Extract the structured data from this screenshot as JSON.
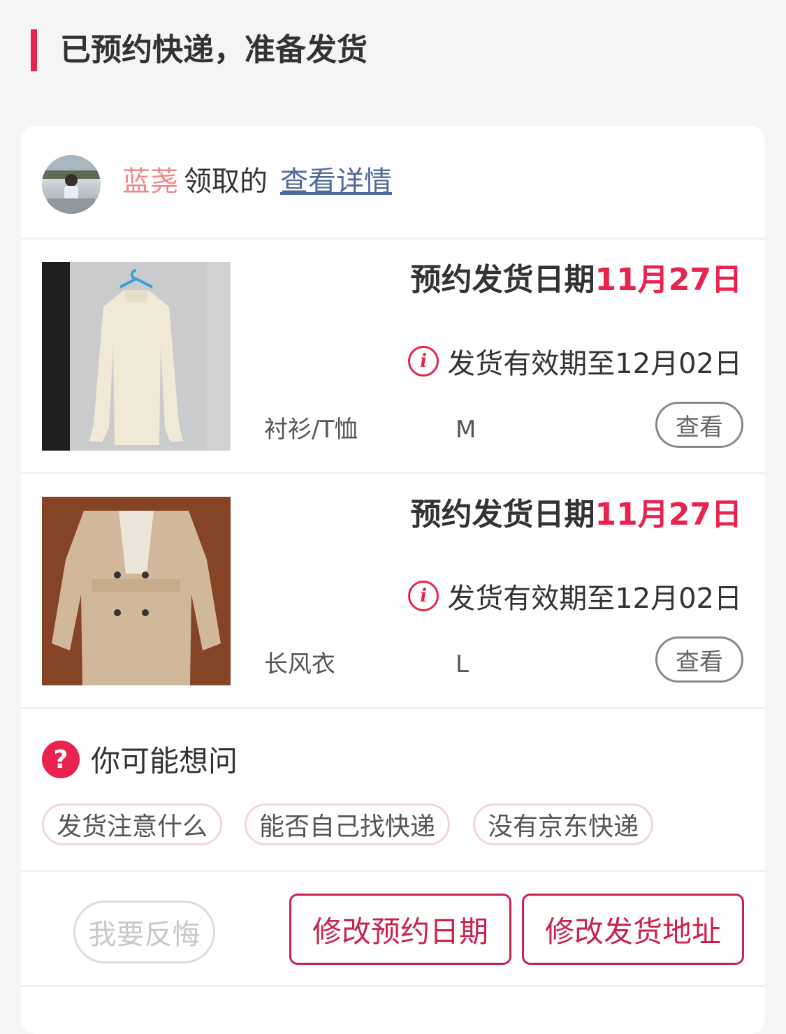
{
  "header": {
    "title": "已预约快递，准备发货"
  },
  "claimer": {
    "name": "蓝荛",
    "verb": "领取的",
    "link": "查看详情"
  },
  "items": [
    {
      "ship_date_label": "预约发货日期",
      "ship_date_value": "11月27日",
      "valid_text": "发货有效期至12月02日",
      "category": "衬衫/T恤",
      "size": "M",
      "view_label": "查看"
    },
    {
      "ship_date_label": "预约发货日期",
      "ship_date_value": "11月27日",
      "valid_text": "发货有效期至12月02日",
      "category": "长风衣",
      "size": "L",
      "view_label": "查看"
    }
  ],
  "faq": {
    "title": "你可能想问",
    "chips": [
      "发货注意什么",
      "能否自己找快递",
      "没有京东快递"
    ]
  },
  "actions": {
    "regret": "我要反悔",
    "change_date": "修改预约日期",
    "change_address": "修改发货地址"
  },
  "icons": {
    "info": "info-icon",
    "question": "question-icon"
  },
  "colors": {
    "accent": "#e8234d",
    "link": "#4f6a9c",
    "name": "#f08a8a"
  }
}
